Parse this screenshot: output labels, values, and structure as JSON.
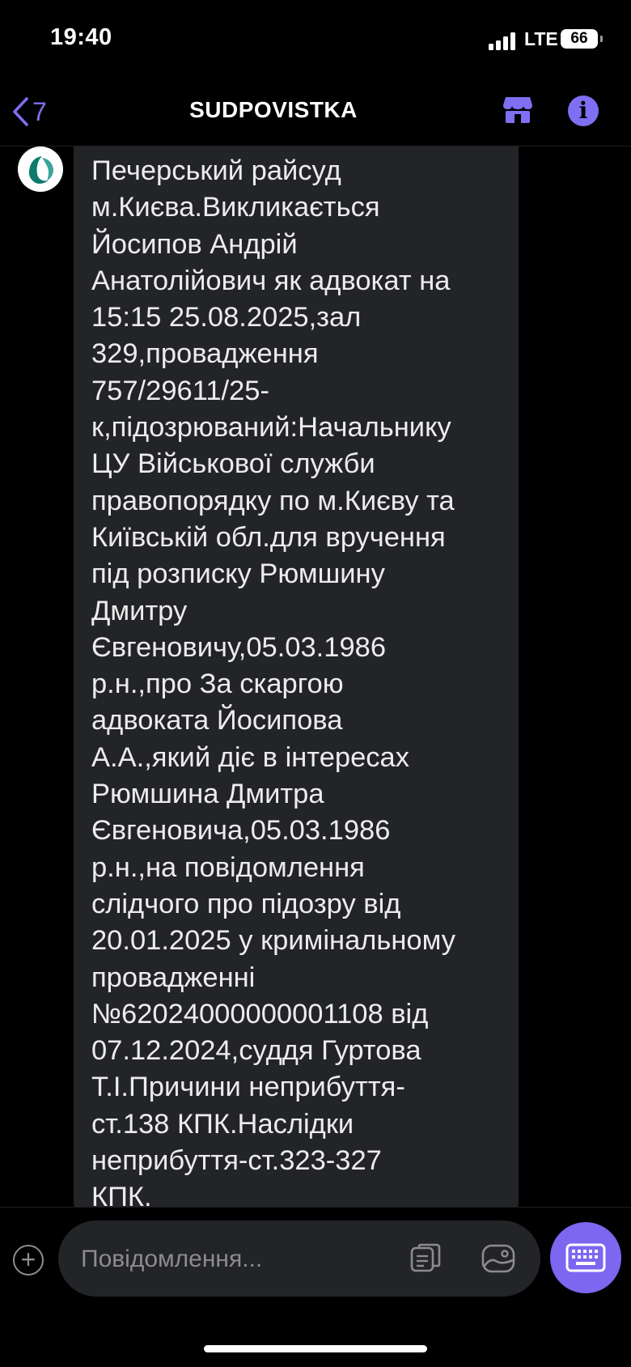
{
  "status_bar": {
    "time": "19:40",
    "network": "LTE",
    "battery": "66"
  },
  "header": {
    "back_count": "7",
    "title": "SUDPOVISTKA",
    "icons": [
      "chevron-left-icon",
      "store-icon",
      "info-icon"
    ]
  },
  "message": {
    "lines": [
      "Печерський райсуд",
      "м.Києва.Викликається",
      "Йосипов Андрій",
      "Анатолійович як адвокат на",
      "15:15 25.08.2025,зал",
      "329,провадження",
      "757/29611/25-",
      "к,підозрюваний:Начальнику",
      "ЦУ Військової служби",
      "правопорядку по м.Києву та",
      "Київській обл.для вручення",
      "під розписку Рюмшину",
      "Дмитру",
      "Євгеновичу,05.03.1986",
      "р.н.,про За скаргою",
      "адвоката Йосипова",
      "А.А.,який діє в інтересах",
      "Рюмшина Дмитра",
      "Євгеновича,05.03.1986",
      "р.н.,на повідомлення",
      "слідчого про підозру від",
      "20.01.2025 у кримінальному",
      "провадженні",
      "№62024000000001108 від",
      "07.12.2024,суддя Гуртова",
      "Т.І.Причини неприбуття-",
      "ст.138 КПК.Наслідки",
      "неприбуття-ст.323-327",
      "КПК."
    ]
  },
  "composer": {
    "placeholder": "Повідомлення...",
    "icons": [
      "plus-icon",
      "sticker-icon",
      "gallery-icon",
      "keyboard-icon"
    ]
  },
  "colors": {
    "accent": "#7f6ff2",
    "bubble": "#232428",
    "background": "#000000"
  }
}
